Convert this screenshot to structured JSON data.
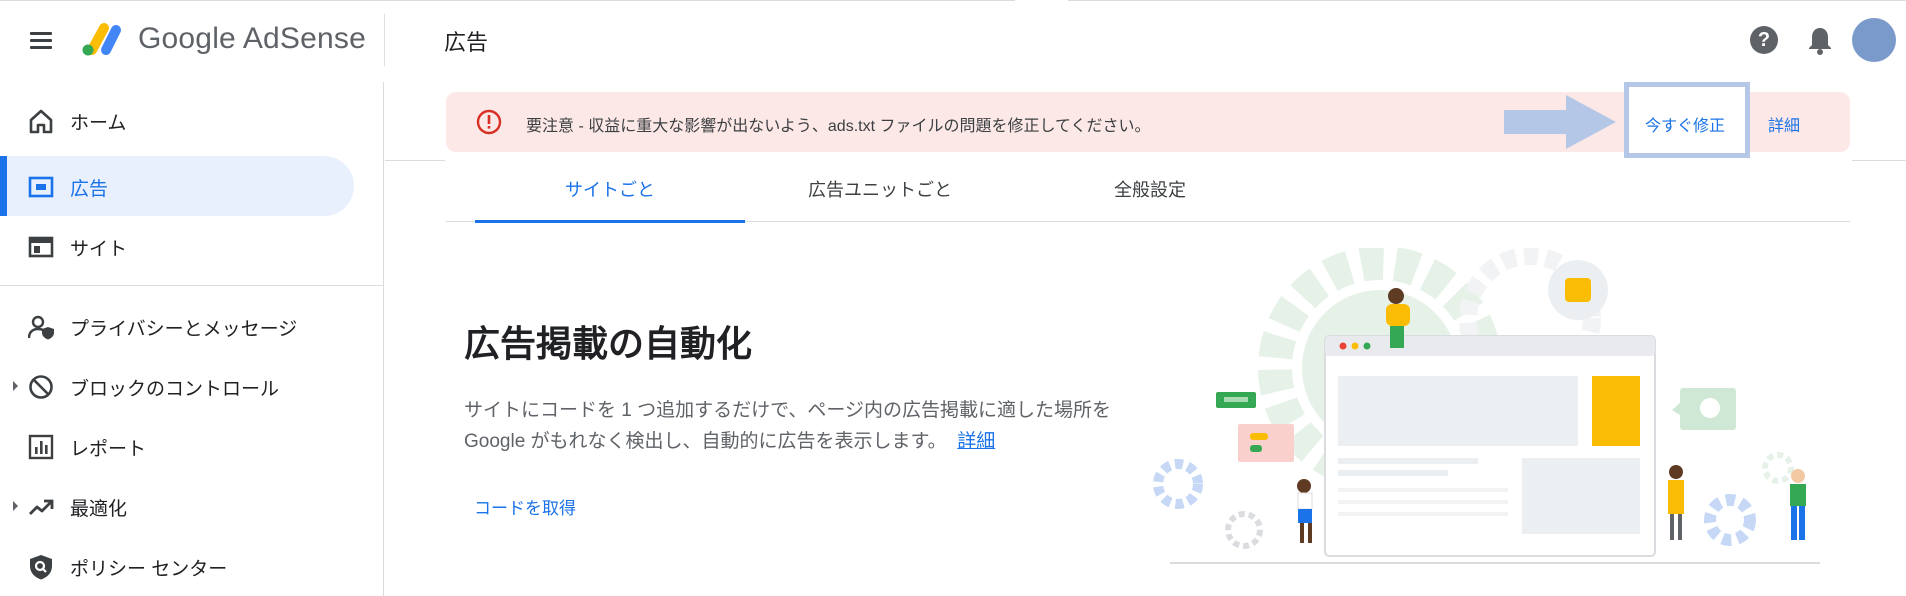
{
  "header": {
    "product_name": "Google AdSense",
    "page_title": "広告"
  },
  "sidebar": {
    "items": [
      {
        "label": "ホーム",
        "icon": "home-icon"
      },
      {
        "label": "広告",
        "icon": "ads-icon",
        "active": true
      },
      {
        "label": "サイト",
        "icon": "sites-icon"
      },
      {
        "label": "プライバシーとメッセージ",
        "icon": "privacy-person-icon"
      },
      {
        "label": "ブロックのコントロール",
        "icon": "block-icon",
        "expandable": true
      },
      {
        "label": "レポート",
        "icon": "reports-icon"
      },
      {
        "label": "最適化",
        "icon": "trending-up-icon",
        "expandable": true
      },
      {
        "label": "ポリシー センター",
        "icon": "policy-shield-icon"
      }
    ]
  },
  "alert": {
    "text": "要注意 - 収益に重大な影響が出ないよう、ads.txt ファイルの問題を修正してください。",
    "fix_label": "今すぐ修正",
    "detail_label": "詳細"
  },
  "tabs": [
    {
      "label": "サイトごと",
      "active": true
    },
    {
      "label": "広告ユニットごと"
    },
    {
      "label": "全般設定"
    }
  ],
  "section": {
    "title": "広告掲載の自動化",
    "description": "サイトにコードを 1 つ追加するだけで、ページ内の広告掲載に適した場所を Google がもれなく検出し、自動的に広告を表示します。",
    "learn_more": "詳細",
    "get_code_label": "コードを取得"
  },
  "colors": {
    "accent": "#1a73e8",
    "alert_background": "#fce8e6",
    "alert_icon": "#d93025",
    "active_nav_background": "#e8f0fe",
    "highlight_box": "#b4c7e7"
  }
}
